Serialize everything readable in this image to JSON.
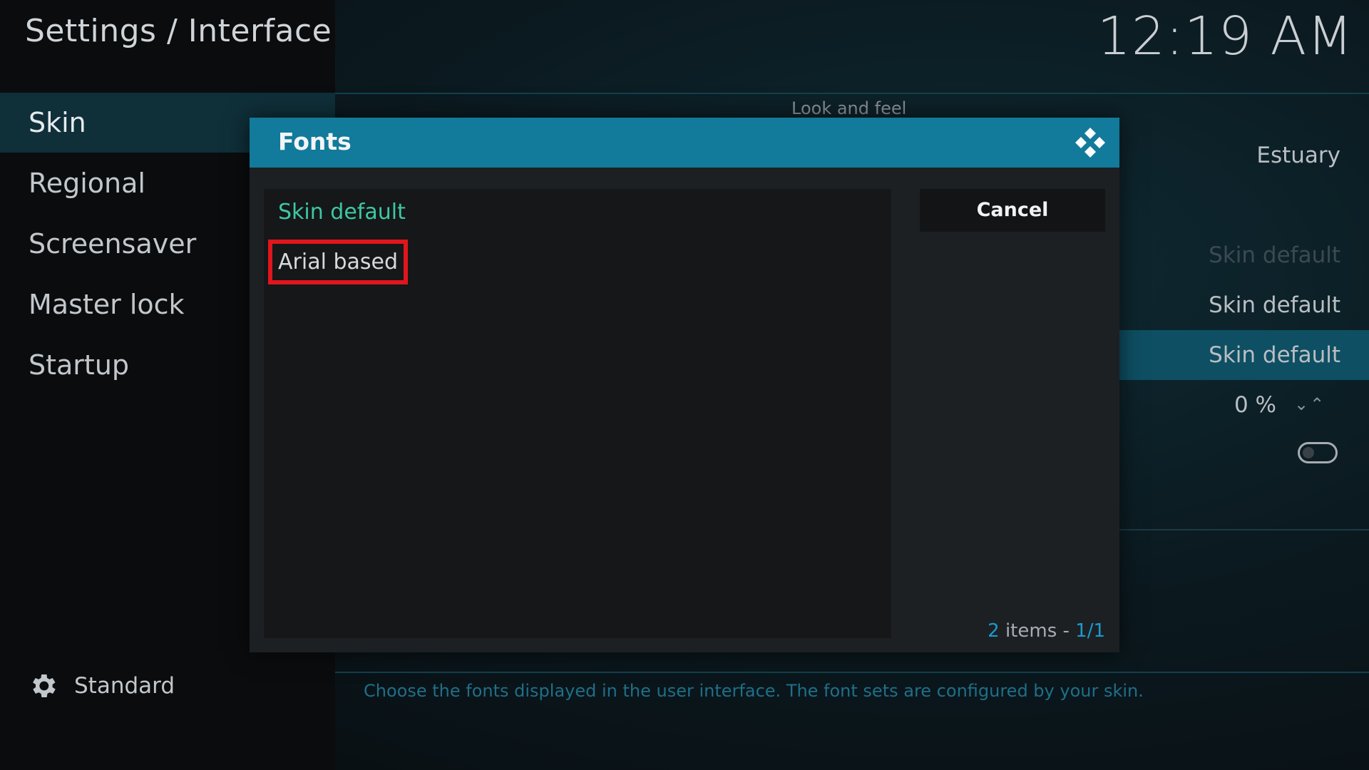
{
  "header": {
    "title": "Settings / Interface",
    "clock": "12:19 AM"
  },
  "sidebar": {
    "items": [
      {
        "label": "Skin",
        "selected": true
      },
      {
        "label": "Regional"
      },
      {
        "label": "Screensaver"
      },
      {
        "label": "Master lock"
      },
      {
        "label": "Startup"
      }
    ],
    "footer_level": "Standard"
  },
  "settings_panel": {
    "section": "Look and feel",
    "values": [
      "Estuary",
      "Skin default",
      "Skin default",
      "Skin default",
      "0 %"
    ],
    "description": "Choose the fonts displayed in the user interface. The font sets are configured by your skin."
  },
  "dialog": {
    "title": "Fonts",
    "items": [
      "Skin default",
      "Arial based"
    ],
    "cancel_label": "Cancel",
    "count": {
      "num": "2",
      "label": " items - ",
      "page": "1/1"
    }
  },
  "colors": {
    "accent": "#127a9a",
    "active_item": "#3ec7a3",
    "highlight": "#e0161c"
  }
}
